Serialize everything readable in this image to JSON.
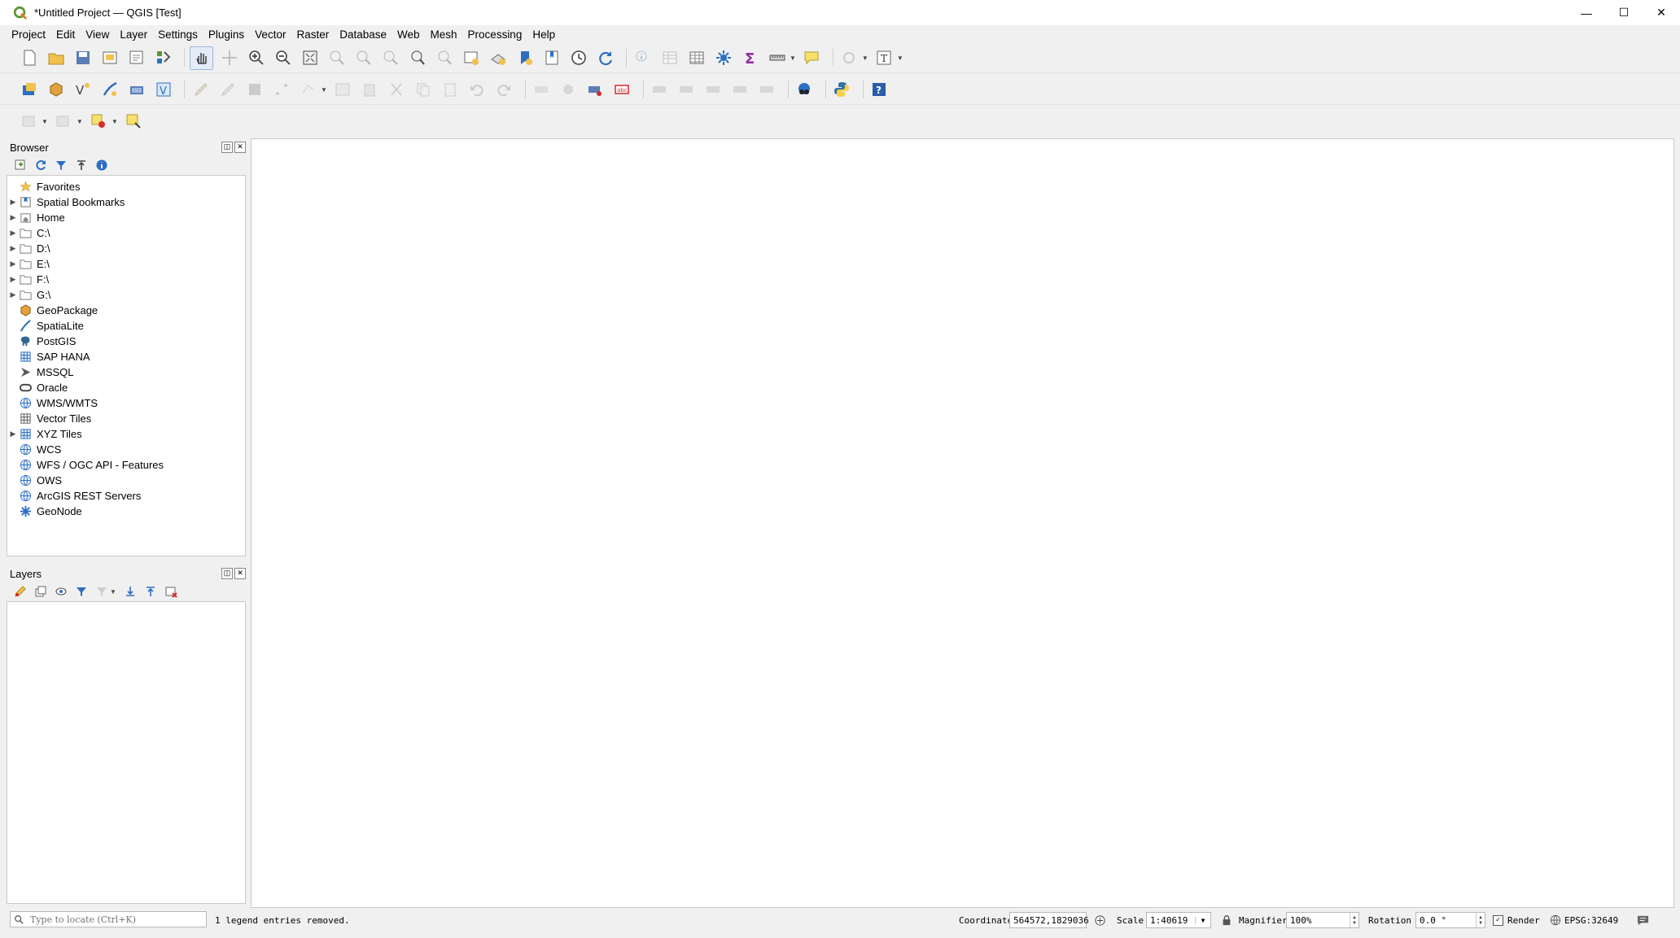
{
  "window": {
    "title": "*Untitled Project — QGIS [Test]",
    "minimize": "—",
    "maximize": "☐",
    "close": "✕"
  },
  "menu": [
    "Project",
    "Edit",
    "View",
    "Layer",
    "Settings",
    "Plugins",
    "Vector",
    "Raster",
    "Database",
    "Web",
    "Mesh",
    "Processing",
    "Help"
  ],
  "browser": {
    "title": "Browser",
    "items": [
      {
        "label": "Favorites",
        "expandable": false,
        "icon": "star-icon"
      },
      {
        "label": "Spatial Bookmarks",
        "expandable": true,
        "icon": "bookmark-icon"
      },
      {
        "label": "Home",
        "expandable": true,
        "icon": "home-folder-icon"
      },
      {
        "label": "C:\\",
        "expandable": true,
        "icon": "folder-icon"
      },
      {
        "label": "D:\\",
        "expandable": true,
        "icon": "folder-icon"
      },
      {
        "label": "E:\\",
        "expandable": true,
        "icon": "folder-icon"
      },
      {
        "label": "F:\\",
        "expandable": true,
        "icon": "folder-icon"
      },
      {
        "label": "G:\\",
        "expandable": true,
        "icon": "folder-icon"
      },
      {
        "label": "GeoPackage",
        "expandable": false,
        "icon": "geopackage-icon"
      },
      {
        "label": "SpatiaLite",
        "expandable": false,
        "icon": "feather-icon"
      },
      {
        "label": "PostGIS",
        "expandable": false,
        "icon": "elephant-icon"
      },
      {
        "label": "SAP HANA",
        "expandable": false,
        "icon": "grid-db-icon"
      },
      {
        "label": "MSSQL",
        "expandable": false,
        "icon": "mssql-icon"
      },
      {
        "label": "Oracle",
        "expandable": false,
        "icon": "oracle-icon"
      },
      {
        "label": "WMS/WMTS",
        "expandable": false,
        "icon": "globe-icon"
      },
      {
        "label": "Vector Tiles",
        "expandable": false,
        "icon": "vector-tiles-icon"
      },
      {
        "label": "XYZ Tiles",
        "expandable": true,
        "icon": "xyz-tiles-icon"
      },
      {
        "label": "WCS",
        "expandable": false,
        "icon": "globe-icon"
      },
      {
        "label": "WFS / OGC API - Features",
        "expandable": false,
        "icon": "globe-icon"
      },
      {
        "label": "OWS",
        "expandable": false,
        "icon": "globe-icon"
      },
      {
        "label": "ArcGIS REST Servers",
        "expandable": false,
        "icon": "globe-icon"
      },
      {
        "label": "GeoNode",
        "expandable": false,
        "icon": "geonode-icon"
      }
    ]
  },
  "layers": {
    "title": "Layers"
  },
  "status": {
    "locator_placeholder": "Type to locate (Ctrl+K)",
    "message": "1 legend entries removed.",
    "coordinate_label": "Coordinate",
    "coordinate_value": "564572,1829036",
    "scale_label": "Scale",
    "scale_value": "1:40619",
    "magnifier_label": "Magnifier",
    "magnifier_value": "100%",
    "rotation_label": "Rotation",
    "rotation_value": "0.0 °",
    "render_label": "Render",
    "crs": "EPSG:32649"
  },
  "colors": {
    "qgis_green": "#589632",
    "folder_yellow": "#f2c14e",
    "accent_blue": "#2b6fc2"
  }
}
